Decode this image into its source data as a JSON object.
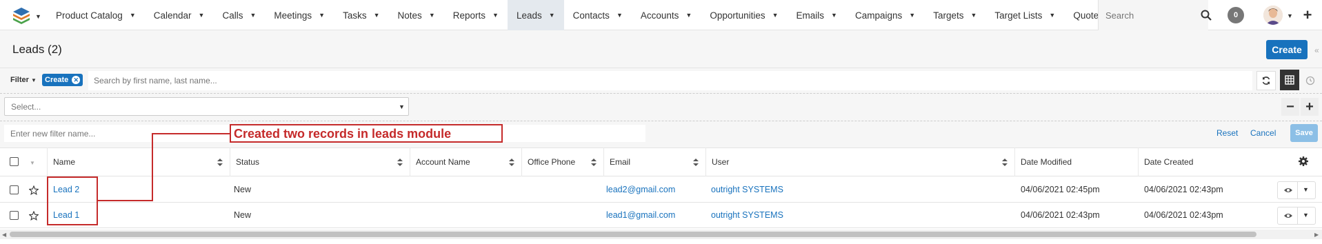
{
  "nav": {
    "items": [
      {
        "label": "Product Catalog",
        "active": false
      },
      {
        "label": "Calendar",
        "active": false
      },
      {
        "label": "Calls",
        "active": false
      },
      {
        "label": "Meetings",
        "active": false
      },
      {
        "label": "Tasks",
        "active": false
      },
      {
        "label": "Notes",
        "active": false
      },
      {
        "label": "Reports",
        "active": false
      },
      {
        "label": "Leads",
        "active": true
      },
      {
        "label": "Contacts",
        "active": false
      },
      {
        "label": "Accounts",
        "active": false
      },
      {
        "label": "Opportunities",
        "active": false
      },
      {
        "label": "Emails",
        "active": false
      },
      {
        "label": "Campaigns",
        "active": false
      },
      {
        "label": "Targets",
        "active": false
      },
      {
        "label": "Target Lists",
        "active": false
      },
      {
        "label": "Quotes",
        "active": false
      }
    ],
    "more_icon": "vertical-ellipsis-icon",
    "search_placeholder": "Search",
    "notification_count": "0"
  },
  "header": {
    "title": "Leads (2)",
    "create_label": "Create"
  },
  "filter": {
    "label": "Filter",
    "pill_label": "Create",
    "search_placeholder": "Search by first name, last name...",
    "select_placeholder": "Select...",
    "name_placeholder": "Enter new filter name...",
    "reset_label": "Reset",
    "cancel_label": "Cancel",
    "save_label": "Save"
  },
  "annotation": {
    "text": "Created two records in leads module",
    "color": "#c52a2a"
  },
  "table": {
    "columns": [
      "Name",
      "Status",
      "Account Name",
      "Office Phone",
      "Email",
      "User",
      "Date Modified",
      "Date Created"
    ],
    "rows": [
      {
        "name": "Lead 2",
        "status": "New",
        "account": "",
        "phone": "",
        "email": "lead2@gmail.com",
        "user": "outright SYSTEMS",
        "modified": "04/06/2021 02:45pm",
        "created": "04/06/2021 02:43pm"
      },
      {
        "name": "Lead 1",
        "status": "New",
        "account": "",
        "phone": "",
        "email": "lead1@gmail.com",
        "user": "outright SYSTEMS",
        "modified": "04/06/2021 02:43pm",
        "created": "04/06/2021 02:43pm"
      }
    ]
  },
  "colors": {
    "accent": "#1872bd",
    "active_tab": "#e4e9ee",
    "annotation": "#c52a2a"
  }
}
